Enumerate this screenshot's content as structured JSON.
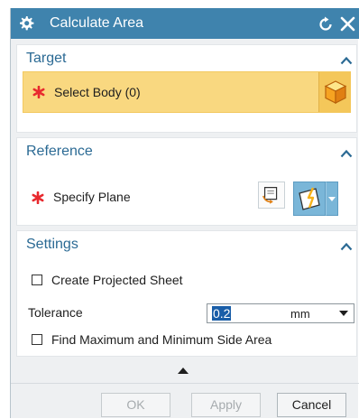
{
  "dialog": {
    "title": "Calculate Area",
    "icons": {
      "settings": "gear-icon",
      "reset": "reset-icon",
      "close": "close-icon"
    }
  },
  "target": {
    "title": "Target",
    "select_body_label": "Select Body (0)",
    "body_icon": "cube-icon"
  },
  "reference": {
    "title": "Reference",
    "specify_plane_label": "Specify Plane"
  },
  "settings": {
    "title": "Settings",
    "create_projected_sheet_label": "Create Projected Sheet",
    "create_projected_sheet_checked": false,
    "tolerance_label": "Tolerance",
    "tolerance_value": "0.2",
    "tolerance_unit": "mm",
    "find_max_min_label": "Find Maximum and Minimum Side Area",
    "find_max_min_checked": false
  },
  "buttons": {
    "ok": "OK",
    "apply": "Apply",
    "cancel": "Cancel"
  },
  "colors": {
    "title_bar": "#3f83ad",
    "group_title": "#2b6a94",
    "required_star": "#e8292e",
    "highlight": "#f9d880"
  }
}
